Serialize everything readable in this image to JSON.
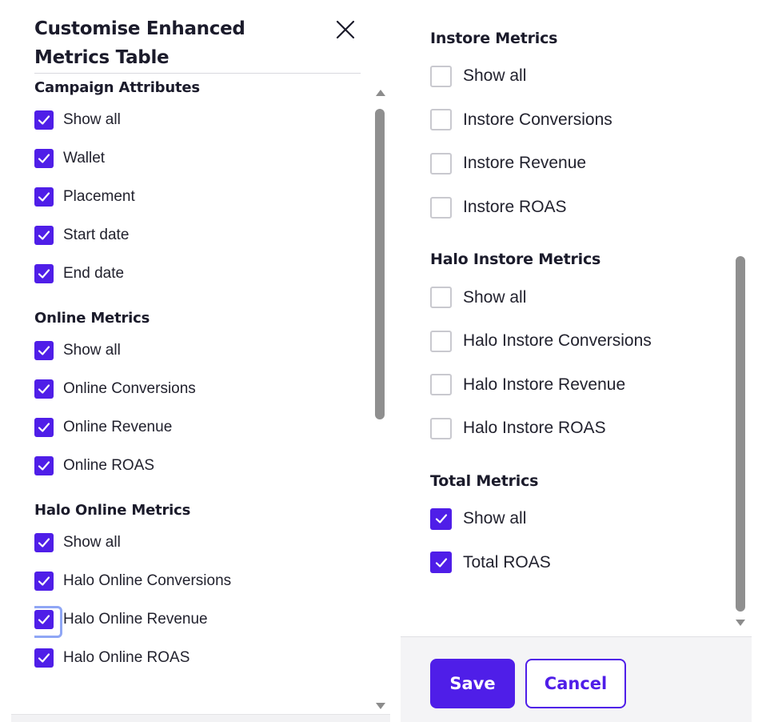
{
  "dialog": {
    "title": "Customise Enhanced Metrics Table",
    "close_icon": "close-icon"
  },
  "left": {
    "sections": [
      {
        "title": "Campaign Attributes",
        "items": [
          {
            "label": "Show all",
            "checked": true
          },
          {
            "label": "Wallet",
            "checked": true
          },
          {
            "label": "Placement",
            "checked": true
          },
          {
            "label": "Start date",
            "checked": true
          },
          {
            "label": "End date",
            "checked": true
          }
        ]
      },
      {
        "title": "Online Metrics",
        "items": [
          {
            "label": "Show all",
            "checked": true
          },
          {
            "label": "Online Conversions",
            "checked": true
          },
          {
            "label": "Online Revenue",
            "checked": true
          },
          {
            "label": "Online ROAS",
            "checked": true
          }
        ]
      },
      {
        "title": "Halo Online Metrics",
        "items": [
          {
            "label": "Show all",
            "checked": true
          },
          {
            "label": "Halo Online Conversions",
            "checked": true
          },
          {
            "label": "Halo Online Revenue",
            "checked": true,
            "focused": true
          },
          {
            "label": "Halo Online ROAS",
            "checked": true
          }
        ]
      }
    ]
  },
  "right": {
    "sections": [
      {
        "title": "Instore Metrics",
        "items": [
          {
            "label": "Show all",
            "checked": false
          },
          {
            "label": "Instore Conversions",
            "checked": false
          },
          {
            "label": "Instore Revenue",
            "checked": false
          },
          {
            "label": "Instore ROAS",
            "checked": false
          }
        ]
      },
      {
        "title": "Halo Instore Metrics",
        "items": [
          {
            "label": "Show all",
            "checked": false
          },
          {
            "label": "Halo Instore Conversions",
            "checked": false
          },
          {
            "label": "Halo Instore Revenue",
            "checked": false
          },
          {
            "label": "Halo Instore ROAS",
            "checked": false
          }
        ]
      },
      {
        "title": "Total Metrics",
        "items": [
          {
            "label": "Show all",
            "checked": true
          },
          {
            "label": "Total ROAS",
            "checked": true
          }
        ]
      }
    ]
  },
  "footer": {
    "save_label": "Save",
    "cancel_label": "Cancel"
  },
  "colors": {
    "accent": "#4f1ee8",
    "focus_ring": "#8fa6f5",
    "scrollbar": "#8f8f8f"
  }
}
